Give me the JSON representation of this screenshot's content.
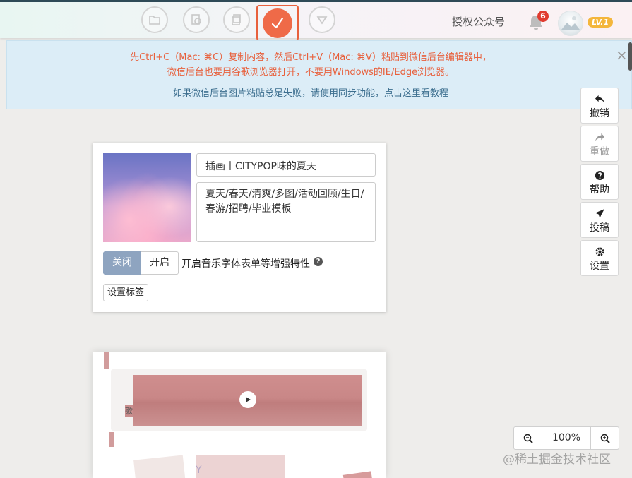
{
  "topbar": {
    "auth_link": "授权公众号",
    "notification_count": "6",
    "level_badge": "LV.1",
    "icons": [
      "folder-icon",
      "sync-icon",
      "copy-icon",
      "check-icon",
      "filter-icon"
    ]
  },
  "notice": {
    "line1": "先Ctrl+C（Mac: ⌘C）复制内容，然后Ctrl+V（Mac: ⌘V）粘贴到微信后台编辑器中，",
    "line2": "微信后台也要用谷歌浏览器打开，不要用Windows的IE/Edge浏览器。",
    "line3_prefix": "如果微信后台图片粘贴总是失败，请使用同步功能，",
    "line3_link": "点击这里看教程",
    "close": "×"
  },
  "tools": {
    "undo": "撤销",
    "redo": "重做",
    "help": "帮助",
    "submit": "投稿",
    "settings": "设置"
  },
  "article": {
    "title": "插画丨CITYPOP味的夏天",
    "description": "夏天/春天/清爽/多图/活动回顾/生日/春游/招聘/毕业模板",
    "toggle_off": "关闭",
    "toggle_on": "开启",
    "toggle_label": "开启音乐字体表单等增强特性",
    "help_mark": "?",
    "tag_button": "设置标签"
  },
  "preview": {
    "song_label": "歌",
    "placeholder_char": "Y"
  },
  "zoom": {
    "value": "100%"
  },
  "watermark": "@稀土掘金技术社区",
  "colors": {
    "accent": "#ef6a48",
    "notice_bg": "#dcedf7",
    "toggle_off_bg": "#8ea4c0",
    "badge": "#e03b2f",
    "level": "#f4b63b"
  }
}
